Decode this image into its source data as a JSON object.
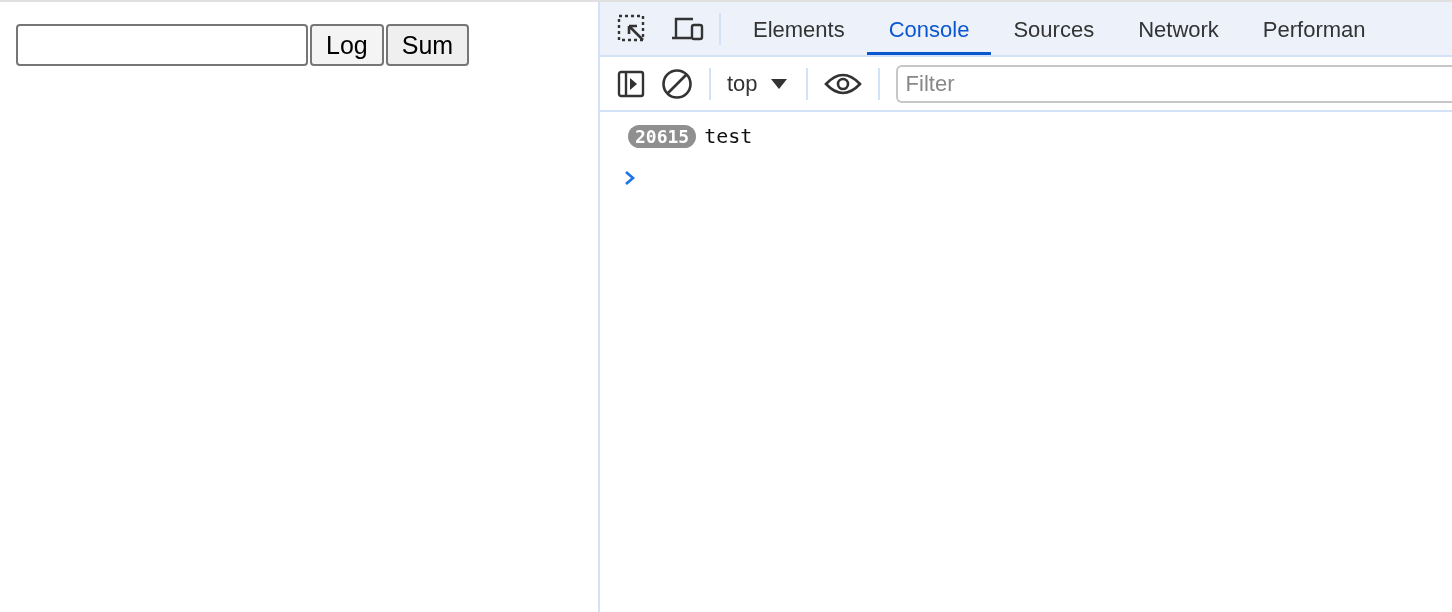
{
  "page": {
    "buttons": [
      {
        "label": "Log"
      },
      {
        "label": "Sum"
      }
    ]
  },
  "devtools": {
    "tabs": [
      {
        "label": "Elements",
        "selected": false
      },
      {
        "label": "Console",
        "selected": true
      },
      {
        "label": "Sources",
        "selected": false
      },
      {
        "label": "Network",
        "selected": false
      },
      {
        "label": "Performan",
        "selected": false
      }
    ],
    "context": "top",
    "filter": {
      "placeholder": "Filter"
    },
    "messages": [
      {
        "count": "20615",
        "text": "test"
      }
    ]
  }
}
